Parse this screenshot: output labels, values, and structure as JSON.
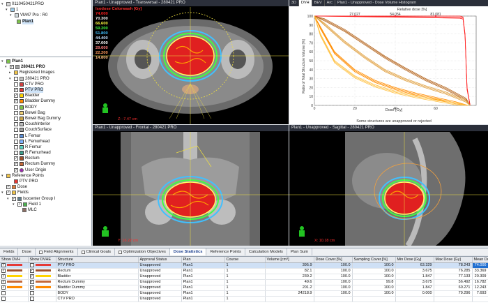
{
  "tree_top": {
    "patient_id": "0110450421PRO",
    "course": "1",
    "plan_header": "VM47 Pro : R0",
    "plan": "Plan1"
  },
  "tree": {
    "root": "Plan1",
    "structure_set": "280421 PRO",
    "registered_images": "Registered Images",
    "image": "280421 PRO",
    "structures": [
      {
        "label": "CTV PRO",
        "color": "#d04040",
        "checked": false
      },
      {
        "label": "PTV PRO",
        "color": "#e53935",
        "checked": true,
        "selected": true
      },
      {
        "label": "Bladder",
        "color": "#ffd400",
        "checked": true
      },
      {
        "label": "Bladder Dummy",
        "color": "#ff8a00",
        "checked": true
      },
      {
        "label": "BODY",
        "color": "#7cc14a",
        "checked": false
      },
      {
        "label": "Bowel Bag",
        "color": "#f2d37a",
        "checked": false
      },
      {
        "label": "Bowel Bag Dummy",
        "color": "#c9a44a",
        "checked": false
      },
      {
        "label": "CouchInterior",
        "color": "#bdbdbd",
        "checked": false
      },
      {
        "label": "CouchSurface",
        "color": "#9e9e9e",
        "checked": false
      },
      {
        "label": "L Femur",
        "color": "#5b8ed6",
        "checked": false
      },
      {
        "label": "L Femurhead",
        "color": "#7fb3ff",
        "checked": false
      },
      {
        "label": "R Femur",
        "color": "#5bd6c2",
        "checked": false
      },
      {
        "label": "R Femurhead",
        "color": "#3fa08e",
        "checked": false
      },
      {
        "label": "Rectum",
        "color": "#a0522d",
        "checked": true
      },
      {
        "label": "Rectum Dummy",
        "color": "#c46a3a",
        "checked": true
      }
    ],
    "user_origin": "User Origin",
    "reference_points": "Reference Points",
    "ref_point": "PTV PRO",
    "dose": "Dose",
    "fields": "Fields",
    "iso_group": "Isocenter Group I",
    "field": "Field 1",
    "mlc": "MLC"
  },
  "viewports": {
    "transversal": "Plan1 - Unapproved - Transversal - 280421 PRO",
    "frontal": "Plan1 - Unapproved - Frontal - 280421 PRO",
    "sagittal": "Plan1 - Unapproved - Sagittal - 280421 PRO",
    "dvh_title": "Plan1 - Unapproved - Dose Volume Histogram",
    "z_label": "Z: -7.47 cm",
    "frontal_label": "Y: 16.22 cm",
    "sagittal_label": "X: 10.18 cm"
  },
  "dvh_tabs": [
    "3D",
    "DVH",
    "BEV",
    "Arc"
  ],
  "isodose": {
    "header": "Isodose Colorwash [Gy]",
    "levels": [
      {
        "value": "74.000",
        "color": "#ff2020"
      },
      {
        "value": "70.300",
        "color": "#ffffff"
      },
      {
        "value": "66.600",
        "color": "#ffff40"
      },
      {
        "value": "59.200",
        "color": "#40ff40"
      },
      {
        "value": "51.800",
        "color": "#40c0ff"
      },
      {
        "value": "44.400",
        "color": "#c0e0ff"
      },
      {
        "value": "37.000",
        "color": "#ffffff"
      },
      {
        "value": "29.600",
        "color": "#ff7a7a"
      },
      {
        "value": "22.200",
        "color": "#ff9b5a"
      },
      {
        "value": "14.800",
        "color": "#ffc080"
      }
    ]
  },
  "chart_data": {
    "type": "line",
    "xlabel": "Dose [Gy]",
    "ylabel": "Ratio of Total Structure Volume [%]",
    "top_axis_label": "Relative dose [%]",
    "xlim": [
      0,
      80
    ],
    "ylim": [
      0,
      100
    ],
    "x_ticks": [
      "0",
      "20",
      "40",
      "60"
    ],
    "y_ticks": [
      "0",
      "10",
      "20",
      "30",
      "40",
      "50",
      "60",
      "70",
      "80",
      "90",
      "100"
    ],
    "top_ticks": [
      "27.027",
      "54.054",
      "81.081"
    ],
    "footnote": "Some structures are unapproved or rejected",
    "series": [
      {
        "color": "#ff2020",
        "x": [
          0,
          72,
          73.5,
          74.5,
          75.5,
          77
        ],
        "y": [
          100,
          100,
          99,
          80,
          20,
          0
        ]
      },
      {
        "color": "#b5651d",
        "x": [
          0,
          5,
          15,
          25,
          35,
          45,
          55,
          65,
          75,
          77
        ],
        "y": [
          100,
          97,
          85,
          70,
          55,
          42,
          30,
          20,
          8,
          0
        ]
      },
      {
        "color": "#e0a040",
        "x": [
          0,
          5,
          15,
          25,
          35,
          45,
          55,
          65,
          75,
          77
        ],
        "y": [
          100,
          92,
          72,
          55,
          40,
          30,
          22,
          15,
          6,
          0
        ]
      },
      {
        "color": "#ff8c00",
        "x": [
          0,
          3,
          10,
          20,
          30,
          40,
          50,
          60,
          70,
          76
        ],
        "y": [
          100,
          88,
          60,
          40,
          28,
          20,
          14,
          9,
          4,
          0
        ]
      },
      {
        "color": "#ffc040",
        "x": [
          0,
          3,
          10,
          20,
          30,
          40,
          50,
          60,
          70,
          76
        ],
        "y": [
          100,
          80,
          50,
          33,
          23,
          16,
          11,
          7,
          3,
          0
        ]
      }
    ]
  },
  "bottom_tabs": [
    {
      "label": "Fields",
      "checkbox": false
    },
    {
      "label": "Dose",
      "checkbox": false
    },
    {
      "label": "Field Alignments",
      "checkbox": true
    },
    {
      "label": "Clinical Goals",
      "checkbox": true
    },
    {
      "label": "Optimization Objectives",
      "checkbox": true
    },
    {
      "label": "Dose Statistics",
      "checkbox": false,
      "active": true
    },
    {
      "label": "Reference Points",
      "checkbox": false
    },
    {
      "label": "Calculation Models",
      "checkbox": false
    },
    {
      "label": "Plan Sum",
      "checkbox": false
    }
  ],
  "table": {
    "headers": [
      "Show DVH",
      "Show DVHE",
      "Structure",
      "Approval Status",
      "Plan",
      "Course",
      "Volume [cm³]",
      "Dose Cover.[%]",
      "Sampling Cover.[%]",
      "Min Dose [Gy]",
      "Max Dose [Gy]",
      "Mean Dose [Gy]"
    ],
    "rows": [
      {
        "color": "#e53935",
        "structure": "PTV PRO",
        "approval": "Unapproved",
        "plan": "Plan1",
        "course": "1",
        "volume": "395.9",
        "dose_cover": "100.0",
        "sampling": "100.0",
        "min": "63.329",
        "max": "78.243",
        "mean": "74.000",
        "selected": true
      },
      {
        "color": "#a0522d",
        "structure": "Rectum",
        "approval": "Unapproved",
        "plan": "Plan1",
        "course": "1",
        "volume": "82.1",
        "dose_cover": "100.0",
        "sampling": "100.0",
        "min": "3.675",
        "max": "76.285",
        "mean": "33.369"
      },
      {
        "color": "#ffd400",
        "structure": "Bladder",
        "approval": "Unapproved",
        "plan": "Plan1",
        "course": "1",
        "volume": "239.2",
        "dose_cover": "100.0",
        "sampling": "100.0",
        "min": "1.847",
        "max": "77.133",
        "mean": "20.309"
      },
      {
        "color": "#c46a3a",
        "structure": "Rectum Dummy",
        "approval": "Unapproved",
        "plan": "Plan1",
        "course": "1",
        "volume": "49.6",
        "dose_cover": "100.0",
        "sampling": "99.8",
        "min": "3.675",
        "max": "56.492",
        "mean": "16.782"
      },
      {
        "color": "#ff8a00",
        "structure": "Bladder Dummy",
        "approval": "Unapproved",
        "plan": "Plan1",
        "course": "1",
        "volume": "201.2",
        "dose_cover": "100.0",
        "sampling": "100.0",
        "min": "1.847",
        "max": "60.271",
        "mean": "12.243"
      },
      {
        "color": "",
        "structure": "BODY",
        "approval": "Unapproved",
        "plan": "Plan1",
        "course": "1",
        "volume": "24218.9",
        "dose_cover": "100.0",
        "sampling": "100.0",
        "min": "0.000",
        "max": "79.296",
        "mean": "7.693"
      },
      {
        "color": "",
        "structure": "CTV PRO",
        "approval": "Unapproved",
        "plan": "Plan1",
        "course": "1",
        "volume": "",
        "dose_cover": "",
        "sampling": "",
        "min": "",
        "max": "",
        "mean": ""
      }
    ]
  }
}
